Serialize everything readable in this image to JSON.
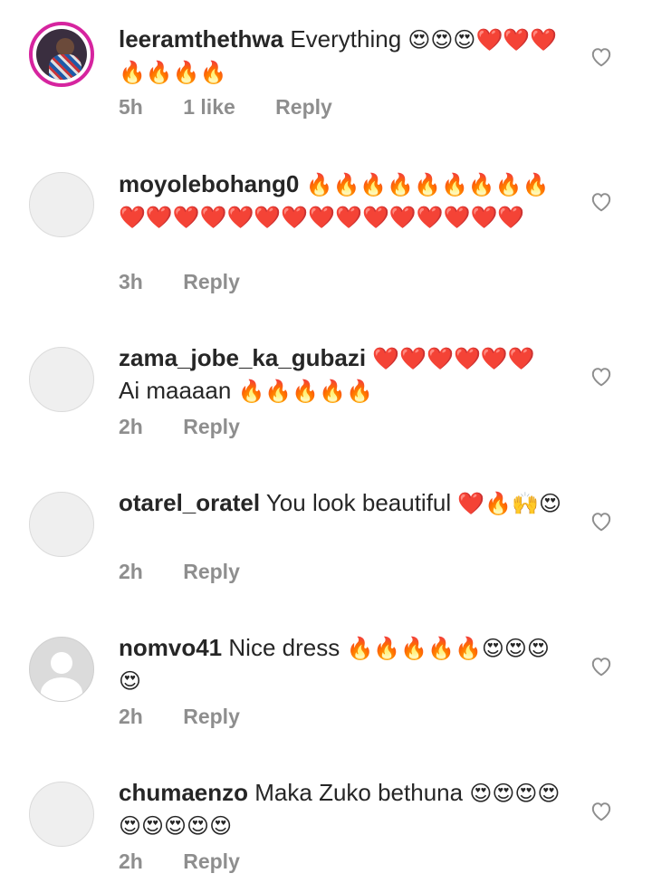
{
  "comments": [
    {
      "username": "leeramthethwa",
      "text": "Everything",
      "emojis": "😍😍😍❤️❤️❤️🔥🔥🔥🔥",
      "time": "5h",
      "likes": "1 like",
      "reply": "Reply",
      "avatar": "photo"
    },
    {
      "username": "moyolebohang0",
      "text": "",
      "emojis": "🔥🔥🔥🔥🔥🔥🔥🔥🔥❤️❤️❤️❤️❤️❤️❤️❤️❤️❤️❤️❤️❤️❤️❤️",
      "time": "3h",
      "likes": "",
      "reply": "Reply",
      "avatar": "blank"
    },
    {
      "username": "zama_jobe_ka_gubazi",
      "text": "",
      "emojis": "❤️❤️❤️❤️❤️❤️",
      "text2": "Ai maaaan",
      "emojis2": "🔥🔥🔥🔥🔥",
      "time": "2h",
      "likes": "",
      "reply": "Reply",
      "avatar": "blank"
    },
    {
      "username": "otarel_oratel",
      "text": "You look beautiful",
      "emojis": "❤️🔥🙌😍",
      "time": "2h",
      "likes": "",
      "reply": "Reply",
      "avatar": "blank"
    },
    {
      "username": "nomvo41",
      "text": "Nice dress",
      "emojis": "🔥🔥🔥🔥🔥😍😍😍😍",
      "time": "2h",
      "likes": "",
      "reply": "Reply",
      "avatar": "default"
    },
    {
      "username": "chumaenzo",
      "text": "Maka Zuko bethuna",
      "emojis": "😍😍😍😍😍😍😍😍😍",
      "time": "2h",
      "likes": "",
      "reply": "Reply",
      "avatar": "blank"
    }
  ],
  "icons": {
    "like": "heart-outline-icon"
  },
  "colors": {
    "meta": "#8e8e8e",
    "text": "#262626"
  }
}
